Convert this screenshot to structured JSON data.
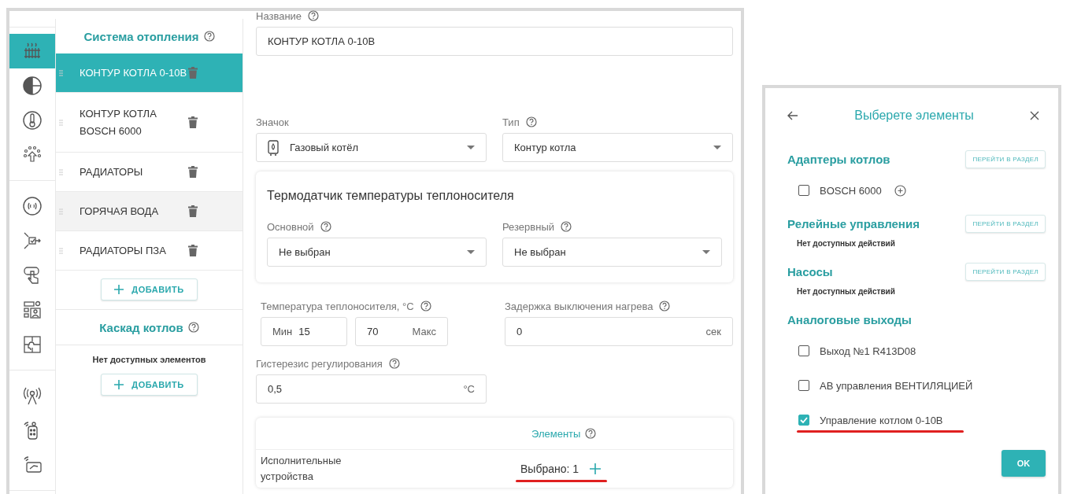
{
  "rail": {
    "groups": [
      [
        {
          "selected": true
        },
        {
          "selected": false
        },
        {
          "selected": false
        },
        {
          "selected": false
        }
      ],
      [
        {
          "selected": false
        },
        {
          "selected": false
        },
        {
          "selected": false
        },
        {
          "selected": false
        },
        {
          "selected": false
        }
      ],
      [
        {
          "selected": false
        },
        {
          "selected": false
        },
        {
          "selected": false
        }
      ]
    ]
  },
  "heating": {
    "title": "Система отопления",
    "help": true,
    "items": [
      {
        "label": "КОНТУР КОТЛА 0-10В",
        "selected": true,
        "hovered": false
      },
      {
        "label": "КОНТУР КОТЛА BOSCH 6000",
        "selected": false,
        "hovered": false
      },
      {
        "label": "РАДИАТОРЫ",
        "selected": false,
        "hovered": false
      },
      {
        "label": "ГОРЯЧАЯ ВОДА",
        "selected": false,
        "hovered": true
      },
      {
        "label": "РАДИАТОРЫ ПЗА",
        "selected": false,
        "hovered": false
      }
    ],
    "add_button": "ДОБАВИТЬ"
  },
  "cascade": {
    "title": "Каскад котлов",
    "help": true,
    "empty": "Нет доступных элементов",
    "add_button": "ДОБАВИТЬ"
  },
  "form": {
    "name": {
      "label": "Название",
      "help": true,
      "value": "КОНТУР КОТЛА 0-10В"
    },
    "icon": {
      "label": "Значок",
      "help": false,
      "value": "Газовый котёл"
    },
    "type": {
      "label": "Тип",
      "help": true,
      "value": "Контур котла"
    },
    "sensor_card": {
      "title": "Термодатчик температуры теплоносителя",
      "main": {
        "label": "Основной",
        "help": true,
        "value": "Не выбран"
      },
      "reserve": {
        "label": "Резервный",
        "help": true,
        "value": "Не выбран"
      }
    },
    "temperature": {
      "label": "Температура теплоносителя, °C",
      "help": true,
      "min_prefix": "Мин",
      "min": "15",
      "max": "70",
      "max_suffix": "Макс"
    },
    "delay": {
      "label": "Задержка выключения нагрева",
      "help": true,
      "value": "0",
      "unit": "сек"
    },
    "hysteresis": {
      "label": "Гистерезис регулирования",
      "help": true,
      "value": "0,5",
      "unit": "°C"
    },
    "elements": {
      "title": "Элементы",
      "help": true,
      "row_label": "Исполнительные устройства",
      "count": "Выбрано: 1",
      "underlined": true
    }
  },
  "dialog": {
    "title": "Выберете элементы",
    "sections": [
      {
        "title": "Адаптеры котлов",
        "button": "ПЕРЕЙТИ В РАЗДЕЛ",
        "items": [
          {
            "label": "BOSCH 6000",
            "checked": false,
            "expandable": true,
            "underlined": false
          }
        ]
      },
      {
        "title": "Релейные управления",
        "button": "ПЕРЕЙТИ В РАЗДЕЛ",
        "empty": "Нет доступных действий"
      },
      {
        "title": "Насосы",
        "button": "ПЕРЕЙТИ В РАЗДЕЛ",
        "empty": "Нет доступных действий"
      },
      {
        "title": "Аналоговые выходы",
        "items": [
          {
            "label": "Выход №1 R413D08",
            "checked": false,
            "expandable": false,
            "underlined": false
          },
          {
            "label": "АВ управления ВЕНТИЛЯЦИЕЙ",
            "checked": false,
            "expandable": false,
            "underlined": false
          },
          {
            "label": "Управление котлом 0-10В",
            "checked": true,
            "expandable": false,
            "underlined": true
          }
        ]
      }
    ],
    "ok": "OK"
  }
}
